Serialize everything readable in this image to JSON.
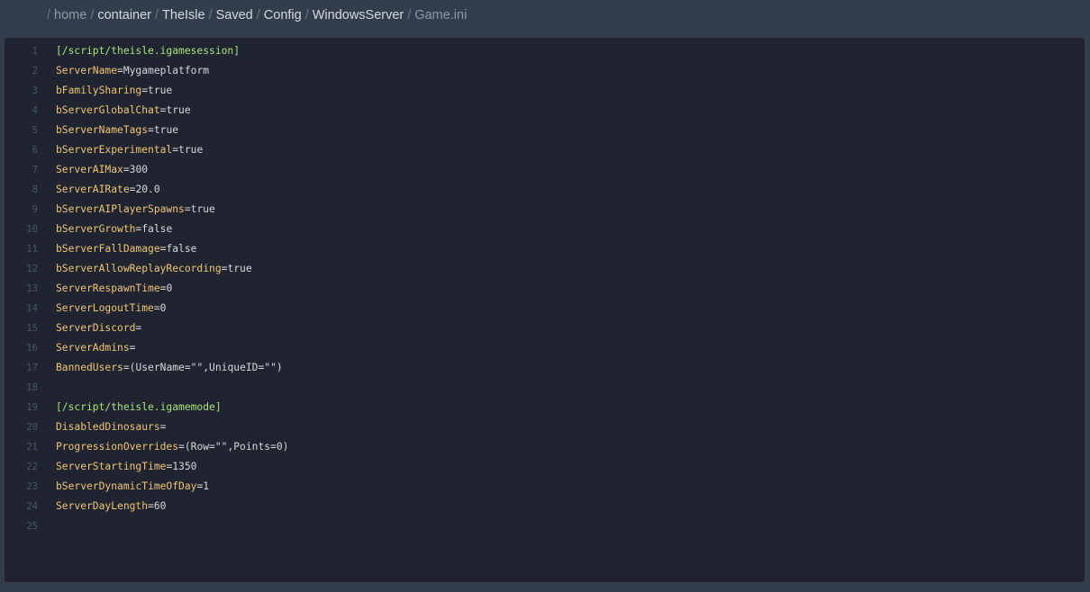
{
  "breadcrumb": {
    "items": [
      {
        "label": "home",
        "style": "muted"
      },
      {
        "label": "container",
        "style": "link"
      },
      {
        "label": "TheIsle",
        "style": "link"
      },
      {
        "label": "Saved",
        "style": "link"
      },
      {
        "label": "Config",
        "style": "link"
      },
      {
        "label": "WindowsServer",
        "style": "link"
      },
      {
        "label": "Game.ini",
        "style": "current"
      }
    ],
    "separator": "/"
  },
  "editor": {
    "lines": [
      {
        "n": "1",
        "section": "[/script/theisle.igamesession]"
      },
      {
        "n": "2",
        "key": "ServerName",
        "value": "Mygameplatform"
      },
      {
        "n": "3",
        "key": "bFamilySharing",
        "value": "true"
      },
      {
        "n": "4",
        "key": "bServerGlobalChat",
        "value": "true"
      },
      {
        "n": "5",
        "key": "bServerNameTags",
        "value": "true"
      },
      {
        "n": "6",
        "key": "bServerExperimental",
        "value": "true"
      },
      {
        "n": "7",
        "key": "ServerAIMax",
        "value": "300"
      },
      {
        "n": "8",
        "key": "ServerAIRate",
        "value": "20.0"
      },
      {
        "n": "9",
        "key": "bServerAIPlayerSpawns",
        "value": "true"
      },
      {
        "n": "10",
        "key": "bServerGrowth",
        "value": "false"
      },
      {
        "n": "11",
        "key": "bServerFallDamage",
        "value": "false"
      },
      {
        "n": "12",
        "key": "bServerAllowReplayRecording",
        "value": "true"
      },
      {
        "n": "13",
        "key": "ServerRespawnTime",
        "value": "0"
      },
      {
        "n": "14",
        "key": "ServerLogoutTime",
        "value": "0"
      },
      {
        "n": "15",
        "key": "ServerDiscord",
        "value": ""
      },
      {
        "n": "16",
        "key": "ServerAdmins",
        "value": ""
      },
      {
        "n": "17",
        "key": "BannedUsers",
        "value": "(UserName=\"\",UniqueID=\"\")"
      },
      {
        "n": "18",
        "text": ""
      },
      {
        "n": "19",
        "section": "[/script/theisle.igamemode]"
      },
      {
        "n": "20",
        "key": "DisabledDinosaurs",
        "value": ""
      },
      {
        "n": "21",
        "key": "ProgressionOverrides",
        "value": "(Row=\"\",Points=0)"
      },
      {
        "n": "22",
        "key": "ServerStartingTime",
        "value": "1350"
      },
      {
        "n": "23",
        "key": "bServerDynamicTimeOfDay",
        "value": "1"
      },
      {
        "n": "24",
        "key": "ServerDayLength",
        "value": "60"
      },
      {
        "n": "25",
        "text": ""
      }
    ]
  }
}
